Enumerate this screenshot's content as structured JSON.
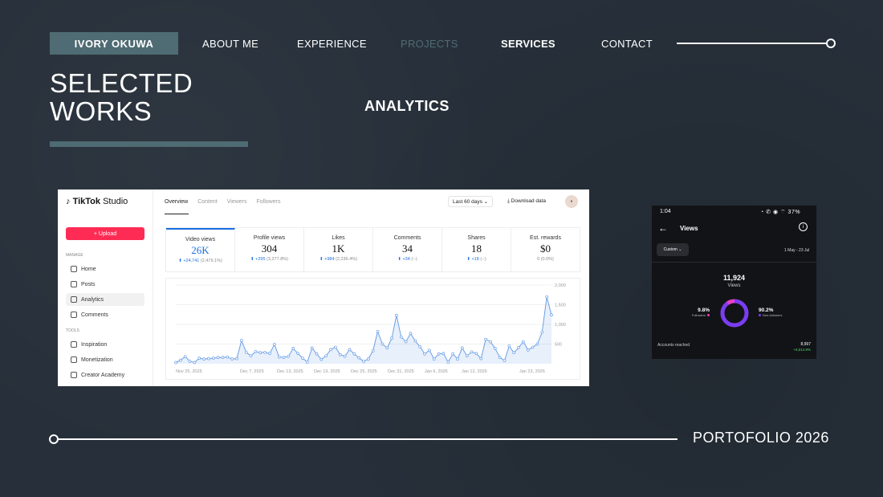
{
  "nav": {
    "brand": "IVORY OKUWA",
    "items": [
      {
        "label": "ABOUT ME",
        "color": "#ffffff",
        "bold": false
      },
      {
        "label": "EXPERIENCE",
        "color": "#ffffff",
        "bold": false
      },
      {
        "label": "PROJECTS",
        "color": "#4f6b73",
        "bold": false
      },
      {
        "label": "SERVICES",
        "color": "#ffffff",
        "bold": true
      },
      {
        "label": "CONTACT",
        "color": "#ffffff",
        "bold": false
      }
    ]
  },
  "title": {
    "line1": "SELECTED",
    "line2": "WORKS"
  },
  "section_heading": "ANALYTICS",
  "footer": {
    "label": "PORTOFOLIO 2026"
  },
  "colors": {
    "accent": "#4f6b73",
    "background": "#27303a",
    "tiktok_red": "#fe2c55",
    "chart_blue": "#1c6fe0"
  },
  "tiktok": {
    "logo": "TikTok",
    "logo_suffix": "Studio",
    "upload": "+ Upload",
    "sections": {
      "manage": "MANAGE",
      "tools": "TOOLS"
    },
    "menu": [
      {
        "label": "Home",
        "icon": "home-icon"
      },
      {
        "label": "Posts",
        "icon": "posts-icon"
      },
      {
        "label": "Analytics",
        "icon": "analytics-icon",
        "active": true
      },
      {
        "label": "Comments",
        "icon": "comments-icon"
      }
    ],
    "tools": [
      {
        "label": "Inspiration",
        "icon": "bulb-icon"
      },
      {
        "label": "Monetization",
        "icon": "dollar-icon"
      },
      {
        "label": "Creator Academy",
        "icon": "academy-icon"
      }
    ],
    "tabs": [
      {
        "label": "Overview",
        "active": true
      },
      {
        "label": "Content"
      },
      {
        "label": "Viewers"
      },
      {
        "label": "Followers"
      }
    ],
    "range_button": "Last 60 days ⌄",
    "download_button": "⤓ Download data",
    "metrics": [
      {
        "label": "Video views",
        "value": "26K",
        "change": "+24,741",
        "pct": "(2,479.1%)",
        "selected": true
      },
      {
        "label": "Profile views",
        "value": "304",
        "change": "+295",
        "pct": "(3,277.8%)"
      },
      {
        "label": "Likes",
        "value": "1K",
        "change": "+984",
        "pct": "(2,236.4%)"
      },
      {
        "label": "Comments",
        "value": "34",
        "change": "+34",
        "pct": "(--)"
      },
      {
        "label": "Shares",
        "value": "18",
        "change": "+18",
        "pct": "(--)"
      },
      {
        "label": "Est. rewards",
        "value": "$0",
        "change": "",
        "pct": "0 (0.0%)"
      }
    ]
  },
  "chart_data": {
    "type": "area",
    "x_ticks": [
      "Nov 25, 2025",
      "Dec 7, 2025",
      "Dec 13, 2025",
      "Dec 19, 2025",
      "Dec 25, 2025",
      "Dec 31, 2025",
      "Jan 6, 2026",
      "Jan 12, 2026",
      "Jan 23, 2026"
    ],
    "y_ticks": [
      "2,000",
      "1,500",
      "1,000",
      "500"
    ],
    "ylim": [
      0,
      2000
    ],
    "grid": true,
    "values": [
      30,
      90,
      180,
      60,
      30,
      140,
      120,
      130,
      140,
      160,
      160,
      170,
      120,
      130,
      590,
      290,
      200,
      310,
      280,
      290,
      260,
      490,
      170,
      160,
      190,
      390,
      260,
      140,
      40,
      400,
      250,
      110,
      200,
      360,
      420,
      230,
      190,
      360,
      250,
      150,
      60,
      120,
      330,
      820,
      500,
      400,
      650,
      1230,
      680,
      560,
      770,
      580,
      430,
      250,
      340,
      120,
      250,
      260,
      40,
      250,
      120,
      400,
      200,
      300,
      260,
      130,
      620,
      560,
      390,
      160,
      80,
      450,
      280,
      410,
      560,
      350,
      420,
      500,
      800,
      1700,
      1240
    ]
  },
  "phone": {
    "time": "1:04",
    "status": "◔ ✆ ◉ ⌔ 37%",
    "title": "Views",
    "info": "i",
    "custom_button": "Custom ⌄",
    "date_range": "1 May - 23 Jul",
    "total": "11,924",
    "total_label": "Views",
    "followers_pct": "9.8%",
    "followers_label": "Followers",
    "non_followers_pct": "90.2%",
    "non_followers_label": "Non-followers",
    "donut": {
      "followers": 9.8,
      "non_followers": 90.2,
      "followers_color": "#e840c8",
      "non_followers_color": "#7a3df0"
    },
    "accounts_reached_label": "Accounts reached",
    "accounts_reached_value": "8,997",
    "accounts_reached_change": "+8,514.8%"
  }
}
